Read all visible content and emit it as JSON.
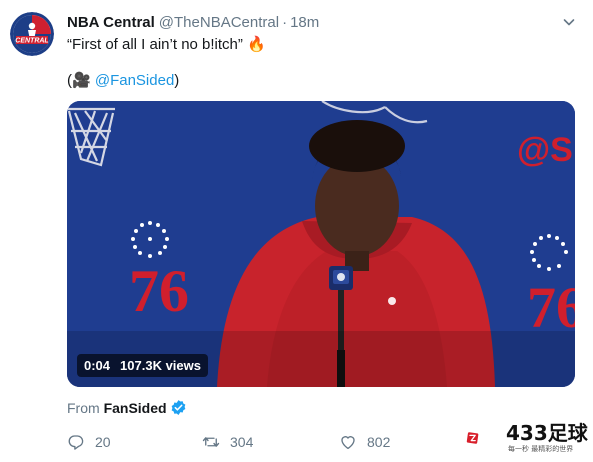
{
  "tweet": {
    "author_name": "NBA Central",
    "author_handle": "@TheNBACentral",
    "separator": "·",
    "time": "18m",
    "line1": "“First of all I ain’t no b!itch” 🔥",
    "credit_prefix": "(🎥 ",
    "credit_mention": "@FanSided",
    "credit_suffix": ")",
    "avatar_text": "CENTRAL"
  },
  "video": {
    "duration": "0:04",
    "views": "107.3K views",
    "backdrop_logo_number": "76",
    "backdrop_logo_number_2": "76",
    "backdrop_tag": "@SIX"
  },
  "source": {
    "prefix": "From ",
    "name": "FanSided"
  },
  "actions": {
    "reply_count": "20",
    "retweet_count": "304",
    "like_count": "802"
  },
  "watermark": {
    "text": "433足球",
    "subtext": "每一秒 最精彩的世界"
  },
  "colors": {
    "link": "#1b95e0",
    "secondary": "#657786",
    "verified": "#1da1f2",
    "sixers_red": "#d01f2d",
    "sixers_blue": "#1d3a8a"
  }
}
